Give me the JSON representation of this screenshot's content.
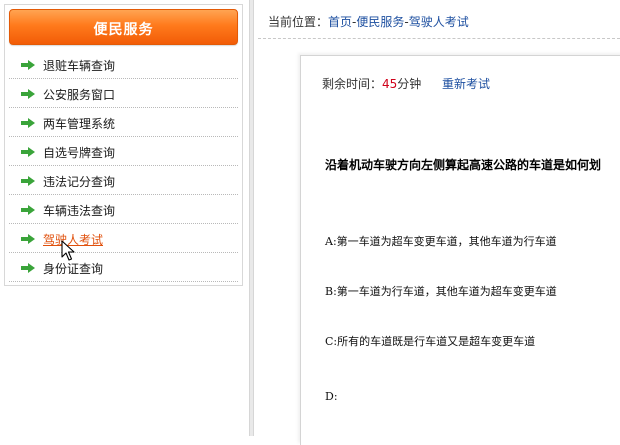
{
  "sidebar": {
    "title": "便民服务",
    "items": [
      {
        "label": "退赃车辆查询"
      },
      {
        "label": "公安服务窗口"
      },
      {
        "label": "两车管理系统"
      },
      {
        "label": "自选号牌查询"
      },
      {
        "label": "违法记分查询"
      },
      {
        "label": "车辆违法查询"
      },
      {
        "label": "驾驶人考试"
      },
      {
        "label": "身份证查询"
      }
    ],
    "active_index": 6
  },
  "breadcrumb": {
    "prefix": "当前位置：",
    "home": "首页",
    "sep1": "-",
    "section": "便民服务",
    "sep2": "-",
    "current": "驾驶人考试"
  },
  "exam": {
    "timer_label": "剩余时间：",
    "timer_value": "45",
    "timer_unit": "分钟",
    "restart_label": "重新考试",
    "question": "沿着机动车驶方向左侧算起高速公路的车道是如何划",
    "options": [
      "A:第一车道为超车变更车道，其他车道为行车道",
      "B:第一车道为行车道，其他车道为超车变更车道",
      "C:所有的车道既是行车道又是超车变更车道",
      "D:"
    ]
  },
  "colors": {
    "header_orange": "#f25c07",
    "arrow_green": "#3aa43a",
    "link_blue": "#1d4fa0",
    "timer_red": "#d0021b",
    "active_orange": "#e0500c"
  }
}
